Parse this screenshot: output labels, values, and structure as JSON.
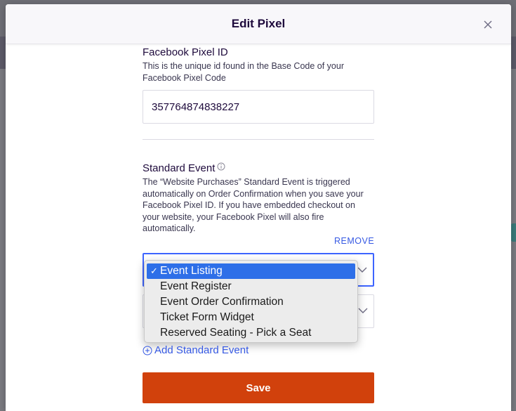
{
  "modal": {
    "title": "Edit Pixel"
  },
  "pixel_id": {
    "label": "Facebook Pixel ID",
    "helper": "This is the unique id found in the Base Code of your Facebook Pixel Code",
    "value": "357764874838227"
  },
  "standard_event": {
    "label": "Standard Event",
    "helper": "The “Website Purchases” Standard Event is triggered automatically on Order Confirmation when you save your Facebook Pixel ID. If you have embedded checkout on your website, your Facebook Pixel will also fire automatically.",
    "remove_label": "REMOVE",
    "add_label": "Add Standard Event"
  },
  "dropdown": {
    "options": [
      "Event Listing",
      "Event Register",
      "Event Order Confirmation",
      "Ticket Form Widget",
      "Reserved Seating - Pick a Seat"
    ],
    "selected": "Event Listing",
    "checkmark": "✓"
  },
  "save_button": {
    "label": "Save"
  },
  "colors": {
    "accent_blue": "#3659e3",
    "save_orange": "#d1410c",
    "selected_blue": "#2e6fe8"
  }
}
